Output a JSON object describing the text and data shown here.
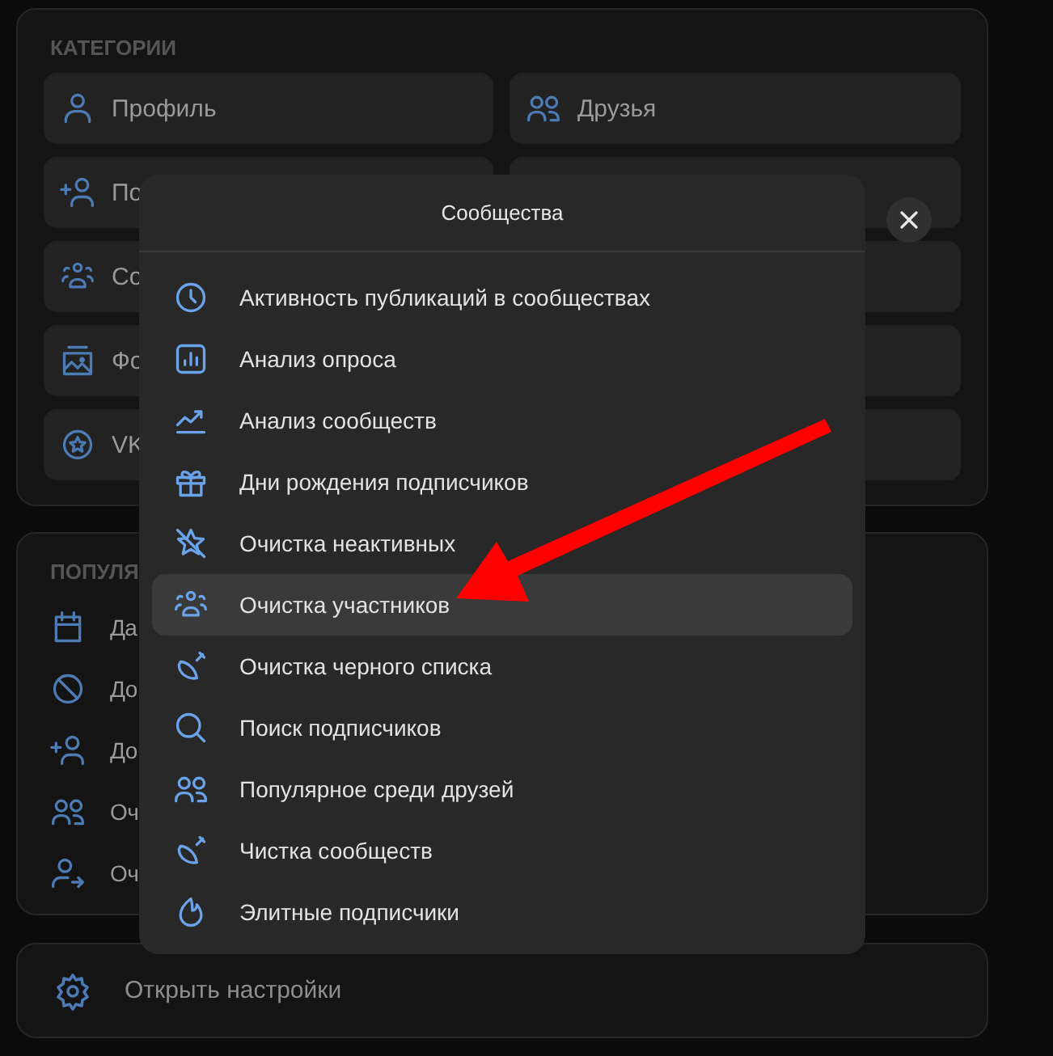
{
  "categories": {
    "heading": "КАТЕГОРИИ",
    "items": [
      {
        "label": "Профиль"
      },
      {
        "label": "Друзья"
      },
      {
        "label": "По"
      },
      {
        "label": "Со"
      },
      {
        "label": "Фо"
      },
      {
        "label": "VK"
      }
    ]
  },
  "popular": {
    "heading": "ПОПУЛЯ",
    "items": [
      {
        "label": "Да"
      },
      {
        "label": "До"
      },
      {
        "label": "До"
      },
      {
        "label": "Оч"
      },
      {
        "label": "Оч"
      }
    ]
  },
  "settings": {
    "label": "Открыть настройки"
  },
  "dialog": {
    "title": "Сообщества",
    "items": [
      {
        "label": "Активность публикаций в сообществах",
        "selected": false
      },
      {
        "label": "Анализ опроса",
        "selected": false
      },
      {
        "label": "Анализ сообществ",
        "selected": false
      },
      {
        "label": "Дни рождения подписчиков",
        "selected": false
      },
      {
        "label": "Очистка неактивных",
        "selected": false
      },
      {
        "label": "Очистка участников",
        "selected": true
      },
      {
        "label": "Очистка черного списка",
        "selected": false
      },
      {
        "label": "Поиск подписчиков",
        "selected": false
      },
      {
        "label": "Популярное среди друзей",
        "selected": false
      },
      {
        "label": "Чистка сообществ",
        "selected": false
      },
      {
        "label": "Элитные подписчики",
        "selected": false
      }
    ]
  }
}
